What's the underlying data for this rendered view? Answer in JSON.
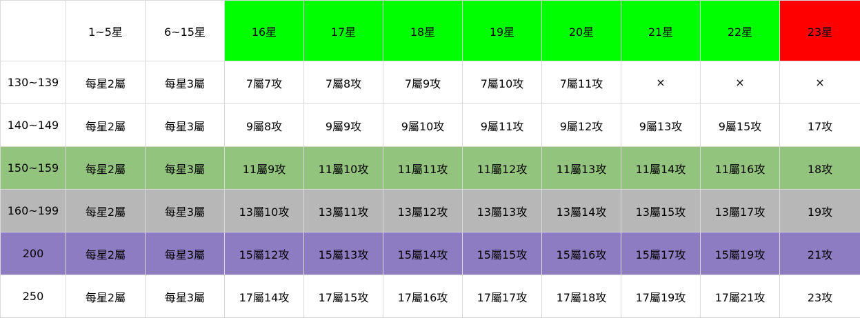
{
  "colors": {
    "header_default": "#ffffff",
    "header_green": "#00ff00",
    "header_red": "#ff0000",
    "row_white": "#ffffff",
    "row_green": "#93c47d",
    "row_gray": "#b7b7b7",
    "row_purple": "#8e7cc3",
    "grid_line": "#d9d9d9"
  },
  "header": {
    "corner": "",
    "cols": [
      {
        "label": "1~5星",
        "color": "#ffffff"
      },
      {
        "label": "6~15星",
        "color": "#ffffff"
      },
      {
        "label": "16星",
        "color": "#00ff00"
      },
      {
        "label": "17星",
        "color": "#00ff00"
      },
      {
        "label": "18星",
        "color": "#00ff00"
      },
      {
        "label": "19星",
        "color": "#00ff00"
      },
      {
        "label": "20星",
        "color": "#00ff00"
      },
      {
        "label": "21星",
        "color": "#00ff00"
      },
      {
        "label": "22星",
        "color": "#00ff00"
      },
      {
        "label": "23星",
        "color": "#ff0000"
      }
    ]
  },
  "rows": [
    {
      "level": "130~139",
      "color": "#ffffff",
      "cells": [
        "每星2屬",
        "每星3屬",
        "7屬7攻",
        "7屬8攻",
        "7屬9攻",
        "7屬10攻",
        "7屬11攻",
        "×",
        "×",
        "×"
      ]
    },
    {
      "level": "140~149",
      "color": "#ffffff",
      "cells": [
        "每星2屬",
        "每星3屬",
        "9屬8攻",
        "9屬9攻",
        "9屬10攻",
        "9屬11攻",
        "9屬12攻",
        "9屬13攻",
        "9屬15攻",
        "17攻"
      ]
    },
    {
      "level": "150~159",
      "color": "#93c47d",
      "cells": [
        "每星2屬",
        "每星3屬",
        "11屬9攻",
        "11屬10攻",
        "11屬11攻",
        "11屬12攻",
        "11屬13攻",
        "11屬14攻",
        "11屬16攻",
        "18攻"
      ]
    },
    {
      "level": "160~199",
      "color": "#b7b7b7",
      "cells": [
        "每星2屬",
        "每星3屬",
        "13屬10攻",
        "13屬11攻",
        "13屬12攻",
        "13屬13攻",
        "13屬14攻",
        "13屬15攻",
        "13屬17攻",
        "19攻"
      ]
    },
    {
      "level": "200",
      "color": "#8e7cc3",
      "cells": [
        "每星2屬",
        "每星3屬",
        "15屬12攻",
        "15屬13攻",
        "15屬14攻",
        "15屬15攻",
        "15屬16攻",
        "15屬17攻",
        "15屬19攻",
        "21攻"
      ]
    },
    {
      "level": "250",
      "color": "#ffffff",
      "cells": [
        "每星2屬",
        "每星3屬",
        "17屬14攻",
        "17屬15攻",
        "17屬16攻",
        "17屬17攻",
        "17屬18攻",
        "17屬19攻",
        "17屬21攻",
        "23攻"
      ]
    }
  ]
}
